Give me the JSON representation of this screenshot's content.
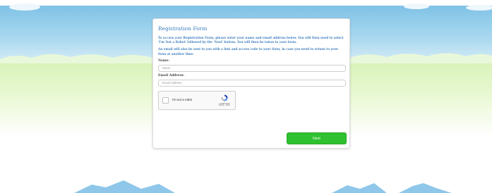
{
  "form": {
    "title": "Registration Form",
    "intro": "To access your Registration Form, please enter your name and email address below. You will then need to select 'I'm Not a Robot' followed by the 'Next' button. You will then be taken to your form.",
    "note": "An email will also be sent to you with a link and access code to your form, in case you need to return to your form at another time.",
    "name_label": "Name:",
    "name_placeholder": "Name",
    "email_label": "Email Address:",
    "email_placeholder": "Email Address",
    "captcha_label": "I'm not a robot",
    "captcha_brand": "reCAPTCHA",
    "captcha_links": "Privacy - Terms",
    "captcha_checked": false,
    "next_label": "Next"
  },
  "colors": {
    "sky_top": "#7fc2e6",
    "grass": "#e2f6c4",
    "accent_text": "#3f7fbf",
    "button_green": "#2fc12f",
    "mountain": "#8ec7ea"
  }
}
